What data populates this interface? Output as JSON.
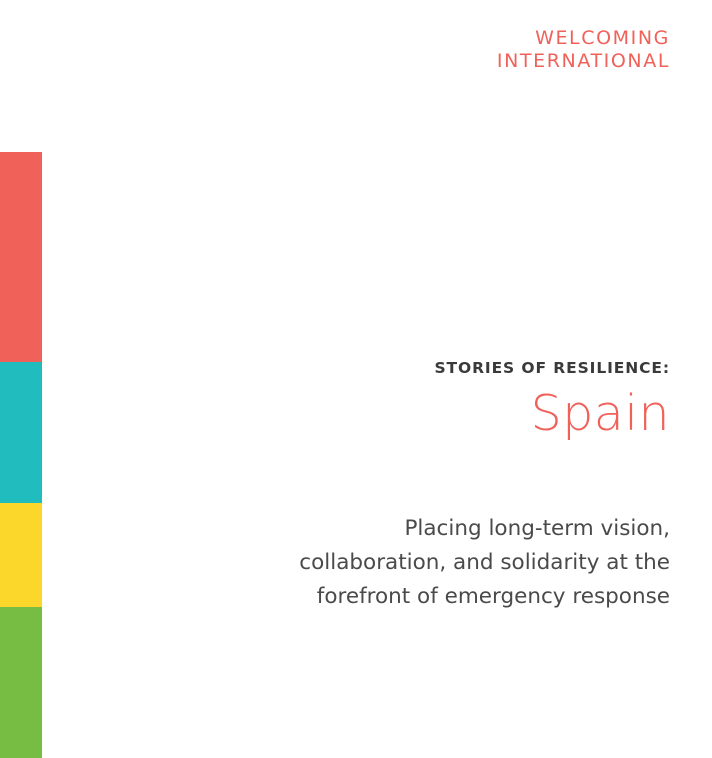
{
  "brand": {
    "line1": "WELCOMING",
    "line2": "INTERNATIONAL",
    "color": "#f0615a"
  },
  "side_bar": {
    "colors": [
      "#f0615a",
      "#20bcbe",
      "#fbd72b",
      "#77bd44"
    ],
    "color_names": [
      "red",
      "teal",
      "yellow",
      "green"
    ]
  },
  "cover": {
    "kicker": "STORIES OF RESILIENCE:",
    "kicker_color": "#3a3a3a",
    "country": "Spain",
    "country_color": "#f0615a",
    "subtitle_lines": [
      "Placing long-term vision,",
      "collaboration, and solidarity at the",
      "forefront of emergency response"
    ],
    "subtitle_color": "#4a4a4a"
  }
}
